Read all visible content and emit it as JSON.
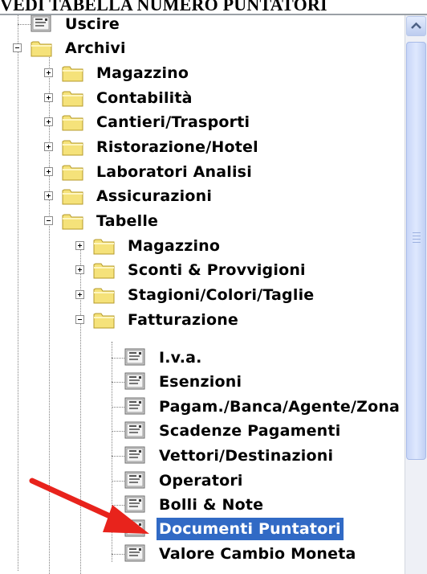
{
  "page_title": "VEDI TABELLA NUMERO PUNTATORI",
  "tree": {
    "uscire": "Uscire",
    "archivi": "Archivi",
    "magazzino": "Magazzino",
    "contabilita": "Contabilità",
    "cantieri": "Cantieri/Trasporti",
    "ristorazione": "Ristorazione/Hotel",
    "laboratori": "Laboratori Analisi",
    "assicurazioni": "Assicurazioni",
    "tabelle": "Tabelle",
    "tab_magazzino": "Magazzino",
    "sconti": "Sconti & Provvigioni",
    "stagioni": "Stagioni/Colori/Taglie",
    "fatturazione": "Fatturazione",
    "iva": "I.v.a.",
    "esenzioni": "Esenzioni",
    "pagamenti": "Pagam./Banca/Agente/Zona",
    "scadenze": "Scadenze Pagamenti",
    "vettori": "Vettori/Destinazioni",
    "operatori": "Operatori",
    "bolli": "Bolli & Note",
    "documenti": "Documenti Puntatori",
    "valore": "Valore Cambio Moneta"
  },
  "icons": {
    "folder": "folder-icon",
    "document": "document-icon",
    "scroll_up": "chevron-up-icon",
    "annotation": "red-arrow-icon"
  },
  "colors": {
    "selection": "#316ac5",
    "folder": "#f5e27a",
    "arrow": "#e8231c",
    "scrollbar": "#c8d6f8"
  }
}
